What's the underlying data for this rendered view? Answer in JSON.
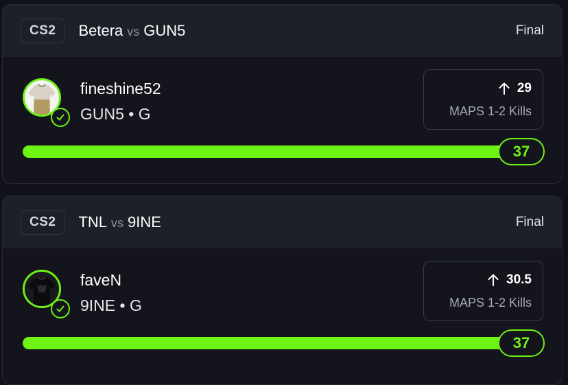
{
  "colors": {
    "accent": "#6df314",
    "background": "#13141c",
    "header": "#1e2029",
    "muted": "#a7a9b2"
  },
  "picks": [
    {
      "league": "CS2",
      "team_a": "Betera",
      "vs": "vs",
      "team_b": "GUN5",
      "status": "Final",
      "player": "fineshine52",
      "player_meta": "GUN5 • G",
      "avatar_icon": "jersey-white-icon",
      "check_icon": "check-circle-icon",
      "direction_icon": "arrow-up-icon",
      "line": "29",
      "stat": "MAPS 1-2 Kills",
      "result": "37",
      "progress_fraction": 1.0
    },
    {
      "league": "CS2",
      "team_a": "TNL",
      "vs": "vs",
      "team_b": "9INE",
      "status": "Final",
      "player": "faveN",
      "player_meta": "9INE • G",
      "avatar_icon": "jersey-black-icon",
      "check_icon": "check-circle-icon",
      "direction_icon": "arrow-up-icon",
      "line": "30.5",
      "stat": "MAPS 1-2 Kills",
      "result": "37",
      "progress_fraction": 1.0
    }
  ]
}
